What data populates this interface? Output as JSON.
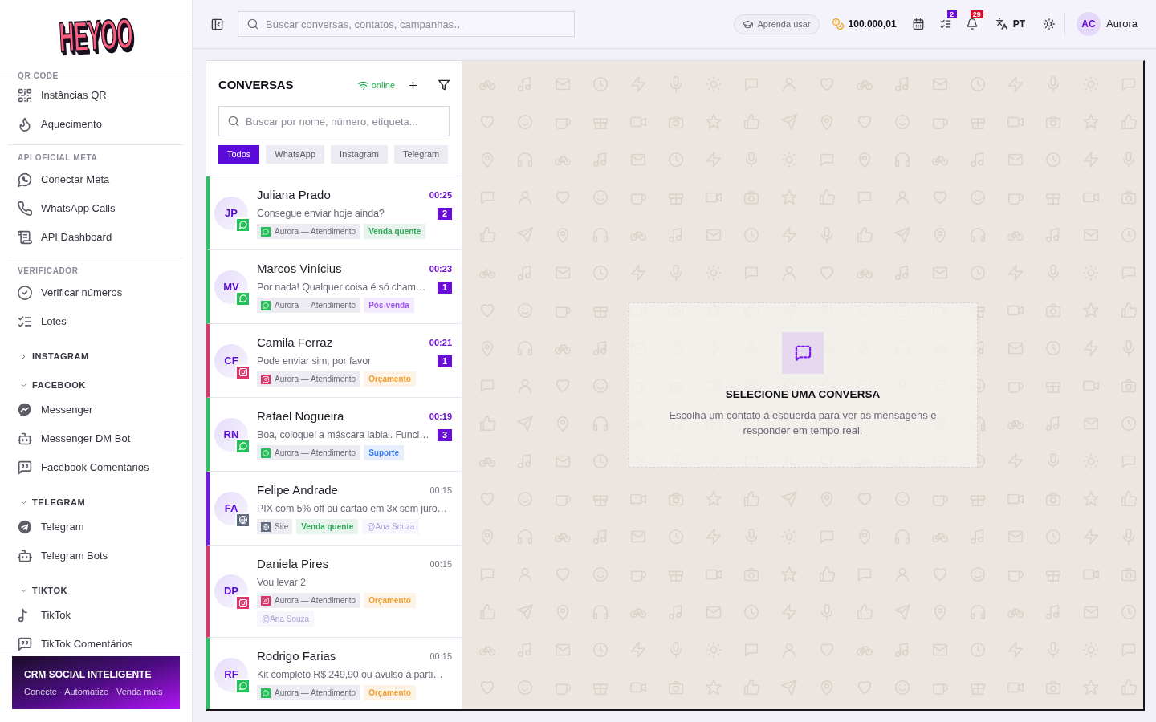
{
  "sidebar": {
    "logo": "HEYOO",
    "nav": [
      {
        "kind": "section",
        "heading": "QR CODE",
        "items": [
          "Instâncias QR",
          "Aquecimento"
        ]
      },
      {
        "kind": "section",
        "heading": "API OFICIAL META",
        "items": [
          "Conectar Meta",
          "WhatsApp Calls",
          "API Dashboard"
        ]
      },
      {
        "kind": "section",
        "heading": "VERIFICADOR",
        "items": [
          "Verificar números",
          "Lotes"
        ]
      },
      {
        "kind": "group",
        "heading": "INSTAGRAM",
        "expanded": false
      },
      {
        "kind": "group",
        "heading": "FACEBOOK",
        "expanded": true,
        "items": [
          "Messenger",
          "Messenger DM Bot",
          "Facebook Comentários"
        ]
      },
      {
        "kind": "group",
        "heading": "TELEGRAM",
        "expanded": true,
        "items": [
          "Telegram",
          "Telegram Bots"
        ]
      },
      {
        "kind": "group",
        "heading": "TIKTOK",
        "expanded": true,
        "items": [
          "TikTok",
          "TikTok Comentários"
        ]
      }
    ],
    "promo": {
      "title": "CRM SOCIAL INTELIGENTE",
      "subtitle": "Conecte · Automatize · Venda mais"
    }
  },
  "header": {
    "search": {
      "placeholder": "Buscar conversas, contatos, campanhas…"
    },
    "help_button": "Aprenda usar",
    "credits": "100.000,01",
    "tasks_count": "2",
    "notifications_count": "29",
    "language": "PT",
    "user": {
      "initials": "AC",
      "name": "Aurora"
    }
  },
  "conversations": {
    "title": "CONVERSAS",
    "status": "online",
    "search": {
      "placeholder": "Buscar por nome, número, etiqueta..."
    },
    "filters": [
      {
        "label": "Todos",
        "selected": true
      },
      {
        "label": "WhatsApp",
        "selected": false
      },
      {
        "label": "Instagram",
        "selected": false
      },
      {
        "label": "Telegram",
        "selected": false
      }
    ],
    "items": [
      {
        "kind": "whatsapp",
        "initials": "JP",
        "name": "Juliana Prado",
        "time": "00:25",
        "preview": "Consegue enviar hoje ainda?",
        "unread": "2",
        "tags": [
          {
            "kind": "whatsapp",
            "label": "Aurora — Atendimento"
          },
          {
            "kind": "label",
            "label": "Venda quente",
            "color": "#2fa85a"
          }
        ]
      },
      {
        "kind": "whatsapp",
        "initials": "MV",
        "name": "Marcos Vinícius",
        "time": "00:23",
        "preview": "Por nada! Qualquer coisa é só cham…",
        "unread": "1",
        "tags": [
          {
            "kind": "whatsapp",
            "label": "Aurora — Atendimento"
          },
          {
            "kind": "label",
            "label": "Pós-venda",
            "color": "#a05af0"
          }
        ]
      },
      {
        "kind": "instagram",
        "initials": "CF",
        "name": "Camila Ferraz",
        "time": "00:21",
        "preview": "Pode enviar sim, por favor",
        "unread": "1",
        "tags": [
          {
            "kind": "instagram",
            "label": "Aurora — Atendimento"
          },
          {
            "kind": "label",
            "label": "Orçamento",
            "color": "#f0a030"
          }
        ]
      },
      {
        "kind": "whatsapp",
        "initials": "RN",
        "name": "Rafael Nogueira",
        "time": "00:19",
        "preview": "Boa, coloquei a máscara labial. Funci…",
        "unread": "3",
        "tags": [
          {
            "kind": "whatsapp",
            "label": "Aurora — Atendimento"
          },
          {
            "kind": "label",
            "label": "Suporte",
            "color": "#3c7ef0"
          }
        ]
      },
      {
        "kind": "site",
        "initials": "FA",
        "name": "Felipe Andrade",
        "time": "00:15",
        "preview": "PIX com 5% off ou cartão em 3x sem juro…",
        "tags": [
          {
            "kind": "site",
            "label": "Site"
          },
          {
            "kind": "label",
            "label": "Venda quente",
            "color": "#2fa85a"
          },
          {
            "kind": "mention",
            "label": "@Ana Souza"
          }
        ]
      },
      {
        "kind": "instagram",
        "initials": "DP",
        "name": "Daniela Pires",
        "time": "00:15",
        "preview": "Vou levar 2",
        "tags": [
          {
            "kind": "instagram",
            "label": "Aurora — Atendimento"
          },
          {
            "kind": "label",
            "label": "Orçamento",
            "color": "#f0a030"
          },
          {
            "kind": "mention",
            "label": "@Ana Souza"
          }
        ]
      },
      {
        "kind": "whatsapp",
        "initials": "RF",
        "name": "Rodrigo Farias",
        "time": "00:15",
        "preview": "Kit completo R$ 249,90 ou avulso a parti…",
        "tags": [
          {
            "kind": "whatsapp",
            "label": "Aurora — Atendimento"
          },
          {
            "kind": "label",
            "label": "Orçamento",
            "color": "#f0a030"
          }
        ]
      }
    ]
  },
  "chat": {
    "empty_state": {
      "title": "SELECIONE UMA CONVERSA",
      "text": "Escolha um contato à esquerda para ver as mensagens e responder em tempo real."
    }
  }
}
